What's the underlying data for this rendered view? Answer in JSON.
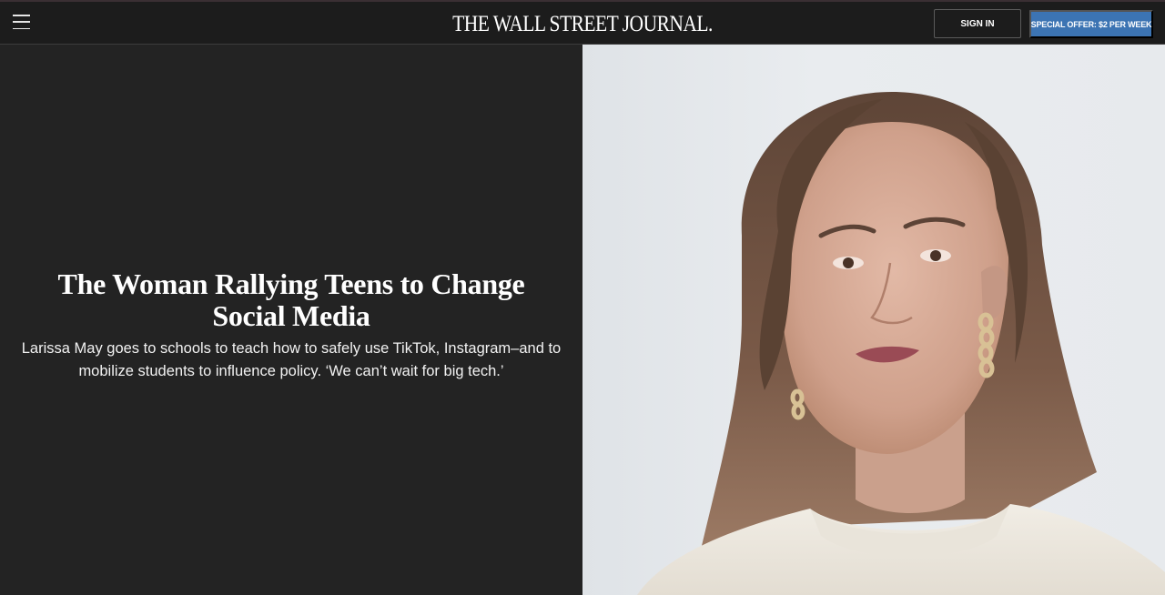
{
  "header": {
    "menu_icon": "hamburger-menu-icon",
    "logo": "THE WALL STREET JOURNAL.",
    "sign_in": "SIGN IN",
    "offer": "SPECIAL OFFER: $2 PER WEEK"
  },
  "article": {
    "headline": "The Woman Rallying Teens to Change Social Media",
    "dek": "Larissa May goes to schools to teach how to safely use TikTok, Instagram–and to mobilize students to influence policy.  ‘We can’t wait for big tech.’"
  },
  "colors": {
    "background": "#232323",
    "topbar": "#1c1c1c",
    "offer_button": "#3c74b3"
  }
}
